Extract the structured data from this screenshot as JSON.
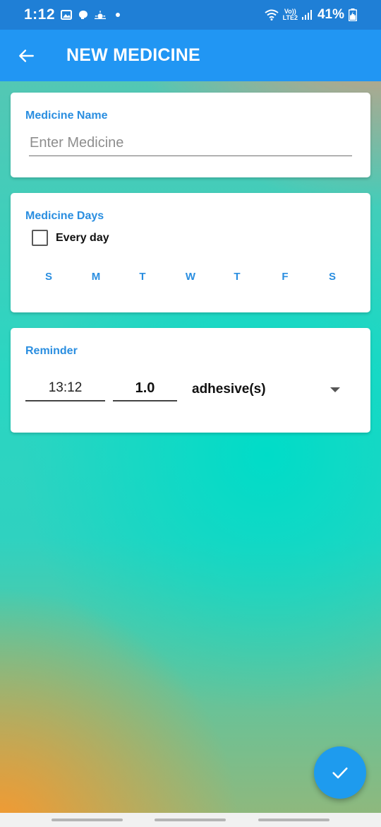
{
  "status_bar": {
    "time": "1:12",
    "network_label_top": "Vo))",
    "network_label_bottom": "LTE2",
    "battery": "41%"
  },
  "app_bar": {
    "title": "NEW MEDICINE"
  },
  "medicine_name_card": {
    "label": "Medicine Name",
    "input_value": "",
    "input_placeholder": "Enter Medicine"
  },
  "medicine_days_card": {
    "label": "Medicine Days",
    "every_day_label": "Every day",
    "every_day_checked": false,
    "days": [
      "S",
      "M",
      "T",
      "W",
      "T",
      "F",
      "S"
    ]
  },
  "reminder_card": {
    "label": "Reminder",
    "time": "13:12",
    "dose": "1.0",
    "unit": "adhesive(s)"
  },
  "colors": {
    "status_bar": "#1f7fd6",
    "app_bar": "#2196f3",
    "accent": "#2a8ee0",
    "fab": "#1e9bee"
  },
  "icons": {
    "back": "arrow-left-icon",
    "fab": "check-icon",
    "dropdown": "caret-down-icon"
  }
}
